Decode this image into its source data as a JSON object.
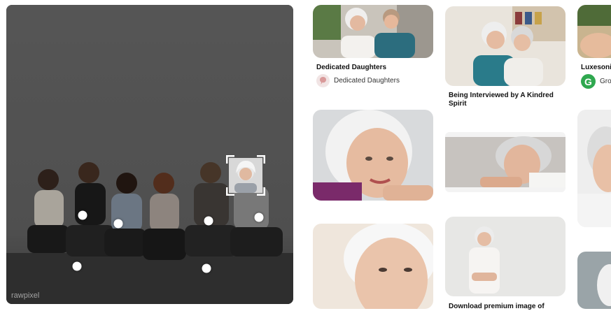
{
  "visual_search": {
    "watermark": "rawpixel"
  },
  "results": [
    {
      "id": "dedicated",
      "title": "Dedicated Daughters",
      "source": "Dedicated Daughters",
      "source_icon": "pinterest-board-icon"
    },
    {
      "id": "interviewed",
      "title": "Being Interviewed by A Kindred Spirit"
    },
    {
      "id": "luxesonic",
      "title": "Luxesonic",
      "source": "Gro",
      "source_icon": "g-logo-icon"
    },
    {
      "id": "download",
      "title": "Download premium image of"
    }
  ],
  "colors": {
    "accent_green": "#2fa84f",
    "panel_bg": "#6b6b6b",
    "dot": "#ffffff"
  }
}
